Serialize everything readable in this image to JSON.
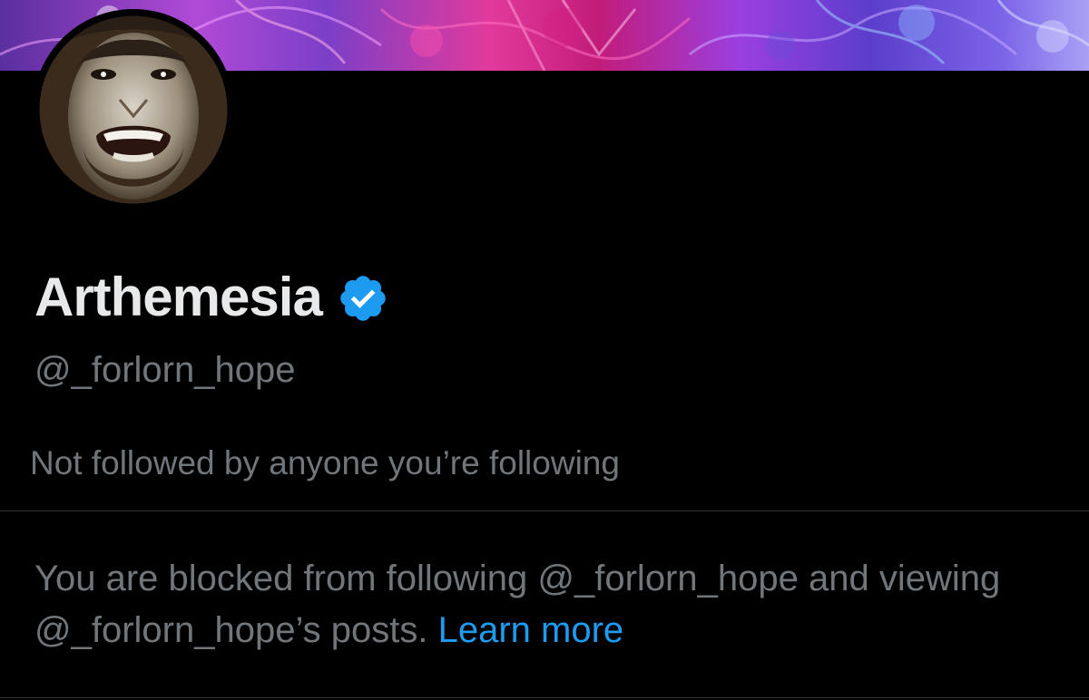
{
  "profile": {
    "display_name": "Arthemesia",
    "handle": "@_forlorn_hope",
    "verified": true,
    "followers_note": "Not followed by anyone you’re following"
  },
  "blocked_notice": {
    "text": "You are blocked from following @_forlorn_hope and viewing @_forlorn_hope’s posts.",
    "link_label": "Learn more"
  },
  "colors": {
    "background": "#000000",
    "primary_text": "#e7e9ea",
    "secondary_text": "#71767b",
    "link": "#1d9bf0",
    "verified": "#1d9bf0",
    "divider": "#2f3336"
  },
  "icons": {
    "verified": "verified-badge-icon"
  }
}
